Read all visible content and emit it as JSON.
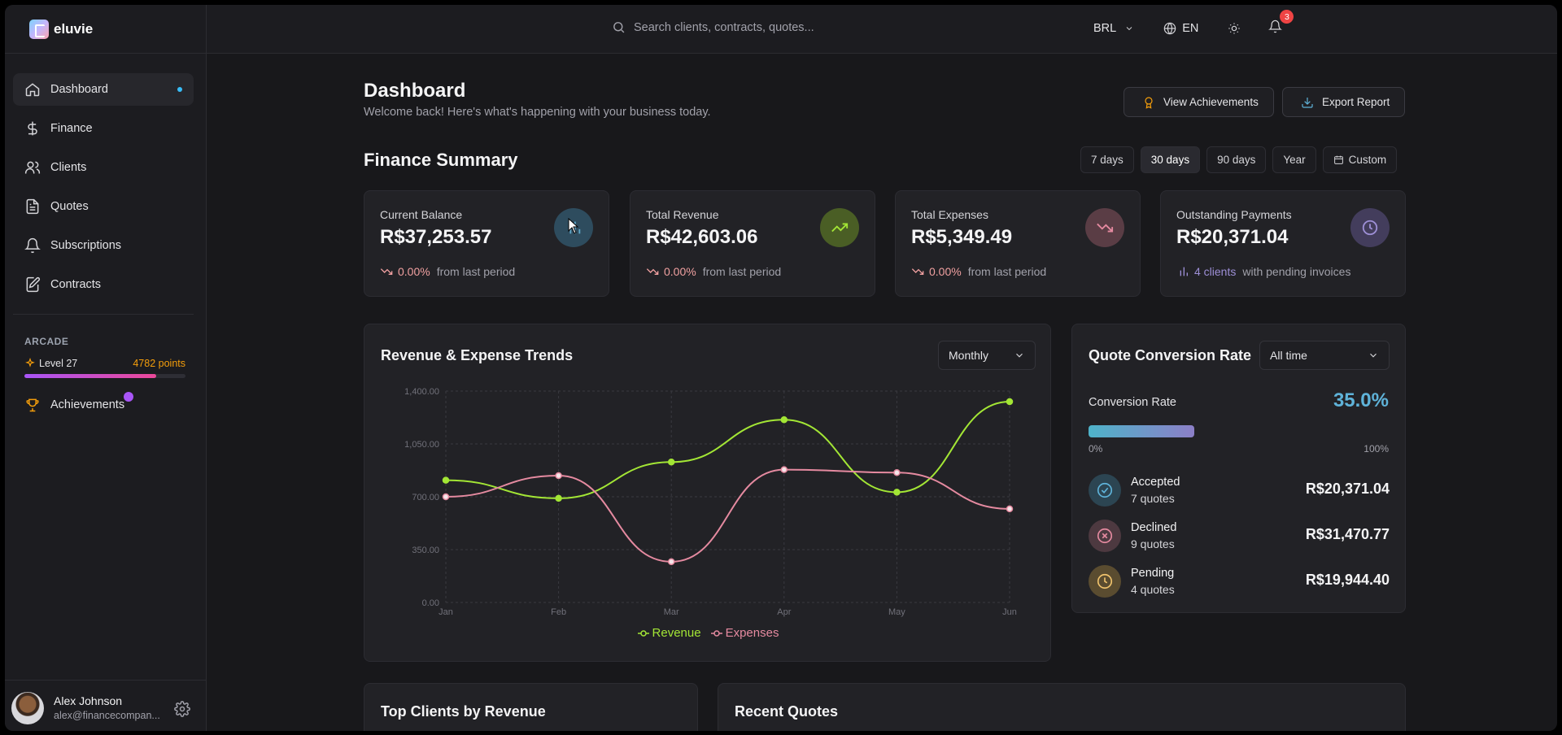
{
  "brand": {
    "name": "eluvie"
  },
  "sidebar": {
    "items": [
      {
        "label": "Dashboard",
        "icon": "home-icon",
        "active": true
      },
      {
        "label": "Finance",
        "icon": "dollar-icon"
      },
      {
        "label": "Clients",
        "icon": "users-icon"
      },
      {
        "label": "Quotes",
        "icon": "document-icon"
      },
      {
        "label": "Subscriptions",
        "icon": "bell-icon"
      },
      {
        "label": "Contracts",
        "icon": "contract-icon"
      }
    ],
    "arcade": {
      "title": "ARCADE",
      "level": "Level 27",
      "points": "4782 points",
      "progress": 0.82,
      "achievements": "Achievements"
    },
    "user": {
      "name": "Alex Johnson",
      "email": "alex@financecompan..."
    }
  },
  "topbar": {
    "search_placeholder": "Search clients, contracts, quotes...",
    "currency": "BRL",
    "language": "EN",
    "notifications": "3"
  },
  "header": {
    "title": "Dashboard",
    "subtitle": "Welcome back! Here's what's happening with your business today.",
    "view_achievements": "View Achievements",
    "export_report": "Export Report"
  },
  "finance_summary": {
    "title": "Finance Summary",
    "ranges": [
      "7 days",
      "30 days",
      "90 days",
      "Year",
      "Custom"
    ],
    "active_range": "30 days",
    "cards": [
      {
        "label": "Current Balance",
        "value": "R$37,253.57",
        "change": "0.00%",
        "note": "from last period",
        "color": "#5fa7c9"
      },
      {
        "label": "Total Revenue",
        "value": "R$42,603.06",
        "change": "0.00%",
        "note": "from last period",
        "color": "#a3e635"
      },
      {
        "label": "Total Expenses",
        "value": "R$5,349.49",
        "change": "0.00%",
        "note": "from last period",
        "color": "#e58aa0"
      },
      {
        "label": "Outstanding Payments",
        "value": "R$20,371.04",
        "change": "4 clients",
        "note": "with pending invoices",
        "color": "#9d8fd6"
      }
    ]
  },
  "trends": {
    "title": "Revenue & Expense Trends",
    "period": "Monthly"
  },
  "chart_data": {
    "type": "line",
    "x": [
      "Jan",
      "Feb",
      "Mar",
      "Apr",
      "May",
      "Jun"
    ],
    "series": [
      {
        "name": "Revenue",
        "color": "#a3e635",
        "values": [
          810,
          690,
          930,
          1210,
          730,
          1330
        ]
      },
      {
        "name": "Expenses",
        "color": "#e58aa0",
        "values": [
          700,
          840,
          270,
          880,
          860,
          620
        ]
      }
    ],
    "ylim": [
      0,
      1400
    ],
    "yticks": [
      "0.00",
      "350.00",
      "700.00",
      "1,050.00",
      "1,400.00"
    ],
    "grid": true,
    "legend": "bottom"
  },
  "conversion": {
    "title": "Quote Conversion Rate",
    "period": "All time",
    "label": "Conversion Rate",
    "rate": "35.0%",
    "rate_fraction": 0.35,
    "min": "0%",
    "max": "100%",
    "rows": [
      {
        "name": "Accepted",
        "count": "7 quotes",
        "amount": "R$20,371.04",
        "color": "#5fb3d9"
      },
      {
        "name": "Declined",
        "count": "9 quotes",
        "amount": "R$31,470.77",
        "color": "#e58aa0"
      },
      {
        "name": "Pending",
        "count": "4 quotes",
        "amount": "R$19,944.40",
        "color": "#f0c36d"
      }
    ]
  },
  "bottom": {
    "top_clients": "Top Clients by Revenue",
    "recent_quotes": "Recent Quotes"
  }
}
